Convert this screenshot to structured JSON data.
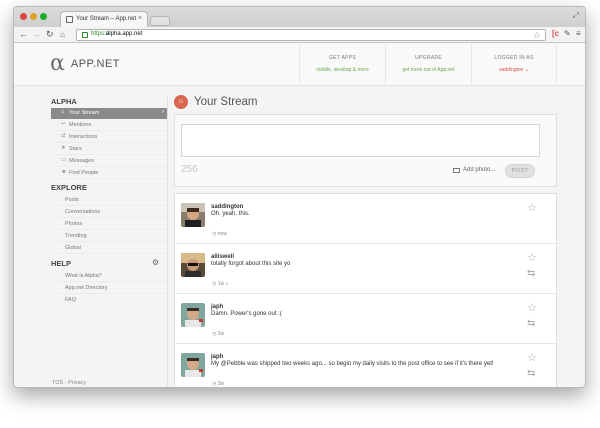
{
  "browser": {
    "tab_title": "Your Stream – App.net",
    "url_protocol": "https://",
    "url_host": "alpha.app.net"
  },
  "header": {
    "logo_text": "APP.NET",
    "get_apps": {
      "title": "GET APPS",
      "subtitle": "mobile, desktop & more"
    },
    "upgrade": {
      "title": "UPGRADE",
      "subtitle": "get more out of App.net"
    },
    "logged_in": {
      "title": "LOGGED IN AS",
      "user": "saddington"
    }
  },
  "sidebar": {
    "alpha_label": "ALPHA",
    "alpha_items": [
      {
        "label": "Your Stream",
        "icon": "home-icon"
      },
      {
        "label": "Mentions",
        "icon": "mention-icon"
      },
      {
        "label": "Interactions",
        "icon": "interactions-icon"
      },
      {
        "label": "Stars",
        "icon": "star-icon"
      },
      {
        "label": "Messages",
        "icon": "message-icon"
      },
      {
        "label": "Find People",
        "icon": "people-icon"
      }
    ],
    "explore_label": "EXPLORE",
    "explore_items": [
      "Posts",
      "Conversations",
      "Photos",
      "Trending",
      "Global"
    ],
    "help_label": "HELP",
    "help_items": [
      "What is Alpha?",
      "App.net Directory",
      "FAQ"
    ],
    "footer": "TOS · Privacy"
  },
  "main": {
    "title": "Your Stream",
    "composer": {
      "char_count": "256",
      "add_photo": "Add photo...",
      "post_button": "POST"
    },
    "posts": [
      {
        "username": "saddington",
        "text": "Oh. yeah. this.",
        "time": "now"
      },
      {
        "username": "alliswell",
        "text": "totally forgot about this site yo",
        "time": "1w"
      },
      {
        "username": "japh",
        "text": "Damn. Power's gone out :(",
        "time": "2w"
      },
      {
        "username": "japh",
        "text": "My @Pebble was shipped two weeks ago... so begin my daily visits to the post office to see if it's there yet!",
        "time": "3w"
      }
    ]
  }
}
